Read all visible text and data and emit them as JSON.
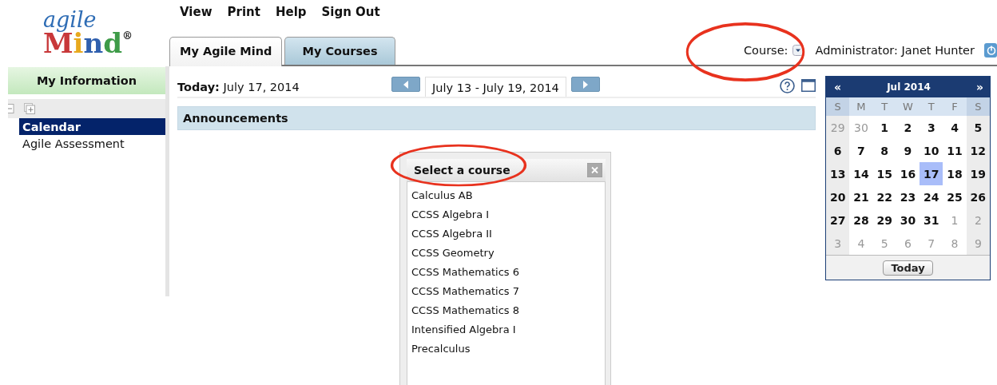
{
  "logo": {
    "top": "agile",
    "letters": [
      {
        "char": "M",
        "color": "#c8383a"
      },
      {
        "char": "i",
        "color": "#e8a91e"
      },
      {
        "char": "n",
        "color": "#2f5fae"
      },
      {
        "char": "d",
        "color": "#3e9b48"
      }
    ],
    "mark": "®"
  },
  "menu": [
    "View",
    "Print",
    "Help",
    "Sign Out"
  ],
  "tabs": [
    {
      "label": "My Agile Mind",
      "selected": true
    },
    {
      "label": "My Courses",
      "selected": false
    }
  ],
  "course_selector": {
    "label": "Course:"
  },
  "user": "Administrator: Janet Hunter",
  "sidebar": {
    "title": "My Information",
    "items": [
      {
        "label": "Calendar",
        "selected": true
      },
      {
        "label": "Agile Assessment",
        "selected": false
      }
    ]
  },
  "today": {
    "label": "Today:",
    "date": "July 17, 2014"
  },
  "week_range": "July 13 - July 19, 2014",
  "announcements": {
    "title": "Announcements"
  },
  "mini_calendar": {
    "prev": "«",
    "title": "Jul 2014",
    "next": "»",
    "weekdays": [
      "S",
      "M",
      "T",
      "W",
      "T",
      "F",
      "S"
    ],
    "weeks": [
      [
        {
          "day": "29",
          "muted": true,
          "selected": false
        },
        {
          "day": "30",
          "muted": true,
          "selected": false
        },
        {
          "day": "1",
          "muted": false,
          "selected": false
        },
        {
          "day": "2",
          "muted": false,
          "selected": false
        },
        {
          "day": "3",
          "muted": false,
          "selected": false
        },
        {
          "day": "4",
          "muted": false,
          "selected": false
        },
        {
          "day": "5",
          "muted": false,
          "selected": false
        }
      ],
      [
        {
          "day": "6",
          "muted": false,
          "selected": false
        },
        {
          "day": "7",
          "muted": false,
          "selected": false
        },
        {
          "day": "8",
          "muted": false,
          "selected": false
        },
        {
          "day": "9",
          "muted": false,
          "selected": false
        },
        {
          "day": "10",
          "muted": false,
          "selected": false
        },
        {
          "day": "11",
          "muted": false,
          "selected": false
        },
        {
          "day": "12",
          "muted": false,
          "selected": false
        }
      ],
      [
        {
          "day": "13",
          "muted": false,
          "selected": false
        },
        {
          "day": "14",
          "muted": false,
          "selected": false
        },
        {
          "day": "15",
          "muted": false,
          "selected": false
        },
        {
          "day": "16",
          "muted": false,
          "selected": false
        },
        {
          "day": "17",
          "muted": false,
          "selected": true
        },
        {
          "day": "18",
          "muted": false,
          "selected": false
        },
        {
          "day": "19",
          "muted": false,
          "selected": false
        }
      ],
      [
        {
          "day": "20",
          "muted": false,
          "selected": false
        },
        {
          "day": "21",
          "muted": false,
          "selected": false
        },
        {
          "day": "22",
          "muted": false,
          "selected": false
        },
        {
          "day": "23",
          "muted": false,
          "selected": false
        },
        {
          "day": "24",
          "muted": false,
          "selected": false
        },
        {
          "day": "25",
          "muted": false,
          "selected": false
        },
        {
          "day": "26",
          "muted": false,
          "selected": false
        }
      ],
      [
        {
          "day": "27",
          "muted": false,
          "selected": false
        },
        {
          "day": "28",
          "muted": false,
          "selected": false
        },
        {
          "day": "29",
          "muted": false,
          "selected": false
        },
        {
          "day": "30",
          "muted": false,
          "selected": false
        },
        {
          "day": "31",
          "muted": false,
          "selected": false
        },
        {
          "day": "1",
          "muted": true,
          "selected": false
        },
        {
          "day": "2",
          "muted": true,
          "selected": false
        }
      ],
      [
        {
          "day": "3",
          "muted": true,
          "selected": false
        },
        {
          "day": "4",
          "muted": true,
          "selected": false
        },
        {
          "day": "5",
          "muted": true,
          "selected": false
        },
        {
          "day": "6",
          "muted": true,
          "selected": false
        },
        {
          "day": "7",
          "muted": true,
          "selected": false
        },
        {
          "day": "8",
          "muted": true,
          "selected": false
        },
        {
          "day": "9",
          "muted": true,
          "selected": false
        }
      ]
    ],
    "today_button": "Today"
  },
  "course_dialog": {
    "title": "Select a course",
    "courses": [
      "Calculus AB",
      "CCSS Algebra I",
      "CCSS Algebra II",
      "CCSS Geometry",
      "CCSS Mathematics 6",
      "CCSS Mathematics 7",
      "CCSS Mathematics 8",
      "Intensified Algebra I",
      "Precalculus"
    ]
  },
  "annotations": [
    {
      "kind": "ellipse"
    },
    {
      "kind": "ellipse"
    }
  ]
}
